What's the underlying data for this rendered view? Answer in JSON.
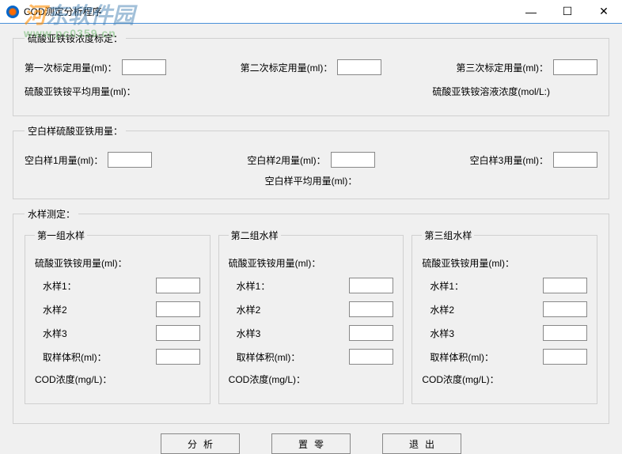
{
  "window": {
    "title": "COD测定分析程序"
  },
  "watermark": {
    "text_main": "河东软件园",
    "text_sub": "www.pc0359.cn"
  },
  "section_calib": {
    "legend": "硫酸亚铁铵浓度标定：",
    "cal1_label": "第一次标定用量(ml)：",
    "cal1_value": "",
    "cal2_label": "第二次标定用量(ml)：",
    "cal2_value": "",
    "cal3_label": "第三次标定用量(ml)：",
    "cal3_value": "",
    "avg_label": "硫酸亚铁铵平均用量(ml)：",
    "conc_label": "硫酸亚铁铵溶液浓度(mol/L:)"
  },
  "section_blank": {
    "legend": "空白样硫酸亚铁用量：",
    "b1_label": "空白样1用量(ml)：",
    "b1_value": "",
    "b2_label": "空白样2用量(ml)：",
    "b2_value": "",
    "b3_label": "空白样3用量(ml)：",
    "b3_value": "",
    "avg_label": "空白样平均用量(ml)："
  },
  "section_sample": {
    "legend": "水样测定：",
    "group_labels": {
      "usage": "硫酸亚铁铵用量(ml)：",
      "s1": "水样1：",
      "s2": "水样2",
      "s3": "水样3",
      "vol": "取样体积(ml)：",
      "cod": "COD浓度(mg/L)："
    },
    "groups": [
      {
        "title": "第一组水样",
        "s1": "",
        "s2": "",
        "s3": "",
        "vol": ""
      },
      {
        "title": "第二组水样",
        "s1": "",
        "s2": "",
        "s3": "",
        "vol": ""
      },
      {
        "title": "第三组水样",
        "s1": "",
        "s2": "",
        "s3": "",
        "vol": ""
      }
    ]
  },
  "buttons": {
    "analyze": "分析",
    "zero": "置零",
    "exit": "退出"
  }
}
